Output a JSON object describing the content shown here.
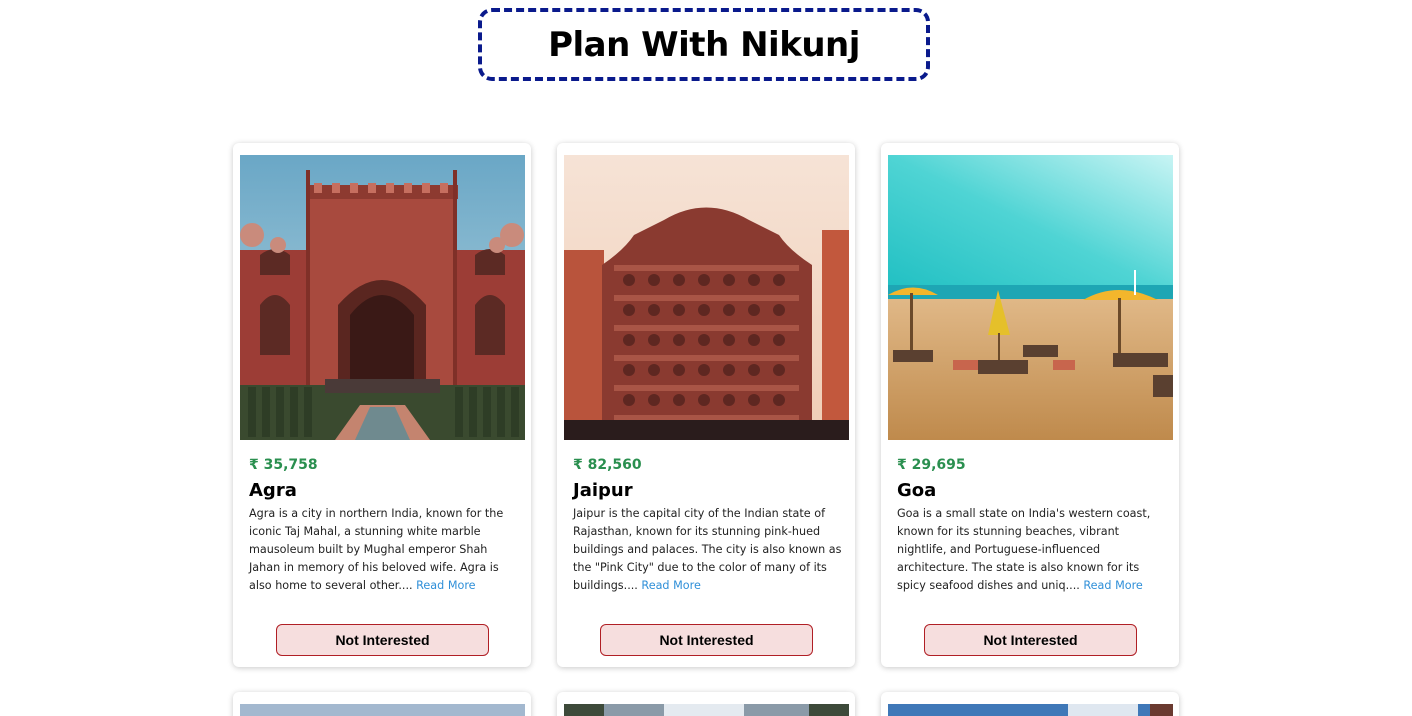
{
  "header": {
    "title": "Plan With Nikunj"
  },
  "tours": [
    {
      "price": "₹ 35,758",
      "name": "Agra",
      "info": "Agra is a city in northern India, known for the iconic Taj Mahal, a stunning white marble mausoleum built by Mughal emperor Shah Jahan in memory of his beloved wife. Agra is also home to several other....",
      "read_more": "Read More",
      "button": "Not Interested"
    },
    {
      "price": "₹ 82,560",
      "name": "Jaipur",
      "info": "Jaipur is the capital city of the Indian state of Rajasthan, known for its stunning pink-hued buildings and palaces. The city is also known as the \"Pink City\" due to the color of many of its buildings....",
      "read_more": "Read More",
      "button": "Not Interested"
    },
    {
      "price": "₹ 29,695",
      "name": "Goa",
      "info": "Goa is a small state on India's western coast, known for its stunning beaches, vibrant nightlife, and Portuguese-influenced architecture. The state is also known for its spicy seafood dishes and uniq....",
      "read_more": "Read More",
      "button": "Not Interested"
    }
  ],
  "colors": {
    "title_border": "#0a1a8c",
    "price": "#2a8f4f",
    "read_more": "#2f8fd8",
    "button_bg": "#f6dede",
    "button_border": "#b01f25"
  }
}
